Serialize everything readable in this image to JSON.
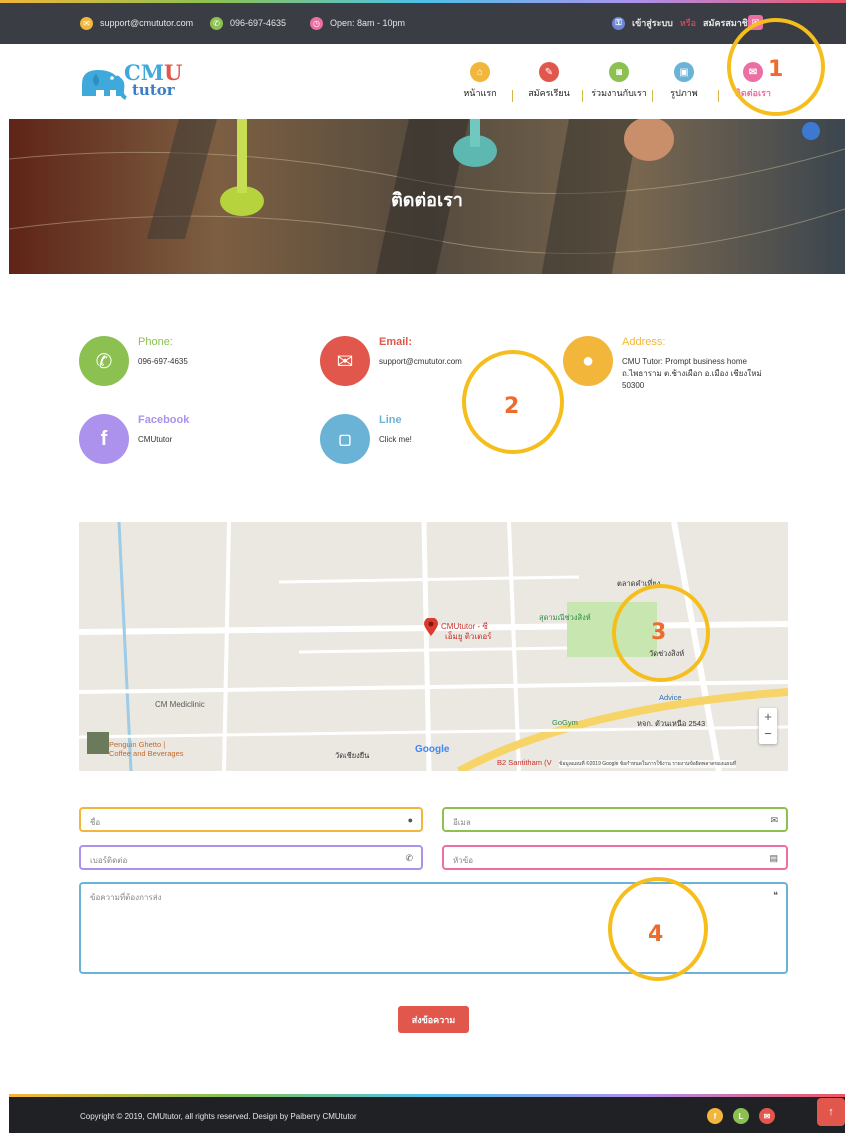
{
  "topbar": {
    "email": "support@cmututor.com",
    "phone": "096-697-4635",
    "hours": "Open: 8am - 10pm",
    "login": "เข้าสู่ระบบ",
    "or": "หรือ",
    "register": "สมัครสมาชิก"
  },
  "logo": {
    "main": "CMU",
    "sub": "tutor"
  },
  "nav": [
    {
      "label": "หน้าแรก",
      "color": "#f2b63a",
      "icon": "home-icon"
    },
    {
      "label": "สมัครเรียน",
      "color": "#e2574c",
      "icon": "pencil-icon"
    },
    {
      "label": "ร่วมงานกับเรา",
      "color": "#8cc152",
      "icon": "camera-icon"
    },
    {
      "label": "รูปภาพ",
      "color": "#6bb3d6",
      "icon": "image-icon"
    },
    {
      "label": "ติดต่อเรา",
      "color": "#ec6fa3",
      "icon": "mail-icon"
    }
  ],
  "hero": {
    "title": "ติดต่อเรา"
  },
  "contacts": {
    "phone": {
      "title": "Phone:",
      "value": "096-697-4635",
      "color": "#8cc152"
    },
    "email": {
      "title": "Email:",
      "value": "support@cmututor.com",
      "color": "#e2574c"
    },
    "address": {
      "title": "Address:",
      "line1": "CMU Tutor: Prompt business home",
      "line2": "ถ.ไพธาราม ต.ช้างเผือก อ.เมือง เชียงใหม่",
      "line3": "50300",
      "color": "#f2b63a"
    },
    "facebook": {
      "title": "Facebook",
      "value": "CMUtutor",
      "color": "#ac92ec"
    },
    "line": {
      "title": "Line",
      "value": "Click me!",
      "color": "#6bb3d6"
    }
  },
  "map": {
    "pin_label_1": "CMUtutor - ซี",
    "pin_label_2": "เอ็มยู ติวเตอร์",
    "labels": [
      "CM Mediclinic",
      "Penguin Ghetto |",
      "Coffee and Beverages",
      "GoGym",
      "Advice",
      "หจก. ตัวนเหนือ 2543",
      "สุดามณีช่วงสิงห์",
      "วัดช่วงสิงห์",
      "ตลาดคำเที่ยง",
      "B2 Santitham (V",
      "วัดเชียงยืน"
    ],
    "google": "Google",
    "footer_text": "ข้อมูลแผนที่ ©2019 Google   ข้อกำหนดในการใช้งาน   รายงานข้อผิดพลาดของแผนที่",
    "zoom_in": "+",
    "zoom_out": "−"
  },
  "form": {
    "name_placeholder": "ชื่อ",
    "email_placeholder": "อีเมล",
    "phone_placeholder": "เบอร์ติดต่อ",
    "subject_placeholder": "หัวข้อ",
    "message_placeholder": "ข้อความที่ต้องการส่ง",
    "send": "ส่งข้อความ"
  },
  "footer": {
    "copyright": "Copyright © 2019, CMUtutor, all rights reserved. Design by Paiberry CMUtutor",
    "social": [
      {
        "label": "f",
        "color": "#f2b63a"
      },
      {
        "label": "L",
        "color": "#8cc152"
      },
      {
        "label": "✉",
        "color": "#e2574c"
      }
    ],
    "totop": "↑"
  },
  "annotations": [
    "1",
    "2",
    "3",
    "4"
  ]
}
